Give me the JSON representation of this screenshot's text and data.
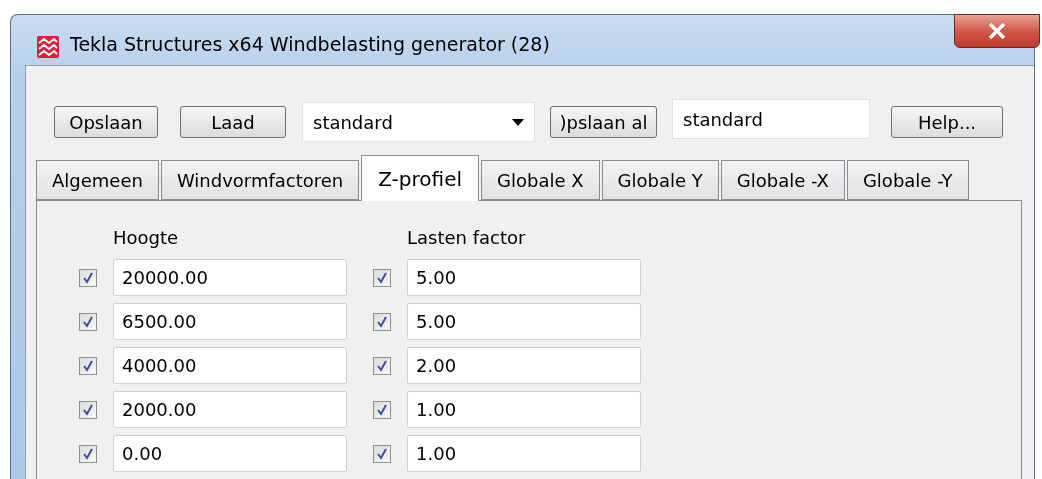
{
  "window": {
    "title": "Tekla Structures x64  Windbelasting generator (28)"
  },
  "toolbar": {
    "save_button": "Opslaan",
    "load_button": "Laad",
    "preset_select": {
      "value": "standard"
    },
    "save_as_button": ")pslaan al",
    "save_as_field": {
      "value": "standard"
    },
    "help_button": "Help..."
  },
  "tabs": [
    {
      "label": "Algemeen",
      "selected": false
    },
    {
      "label": "Windvormfactoren",
      "selected": false
    },
    {
      "label": "Z-profiel",
      "selected": true
    },
    {
      "label": "Globale X",
      "selected": false
    },
    {
      "label": "Globale Y",
      "selected": false
    },
    {
      "label": "Globale -X",
      "selected": false
    },
    {
      "label": "Globale -Y",
      "selected": false
    }
  ],
  "columns": [
    {
      "header": "Hoogte",
      "rows": [
        {
          "checked": true,
          "value": "20000.00"
        },
        {
          "checked": true,
          "value": "6500.00"
        },
        {
          "checked": true,
          "value": "4000.00"
        },
        {
          "checked": true,
          "value": "2000.00"
        },
        {
          "checked": true,
          "value": "0.00"
        }
      ]
    },
    {
      "header": "Lasten factor",
      "rows": [
        {
          "checked": true,
          "value": "5.00"
        },
        {
          "checked": true,
          "value": "5.00"
        },
        {
          "checked": true,
          "value": "2.00"
        },
        {
          "checked": true,
          "value": "1.00"
        },
        {
          "checked": true,
          "value": "1.00"
        }
      ]
    }
  ]
}
